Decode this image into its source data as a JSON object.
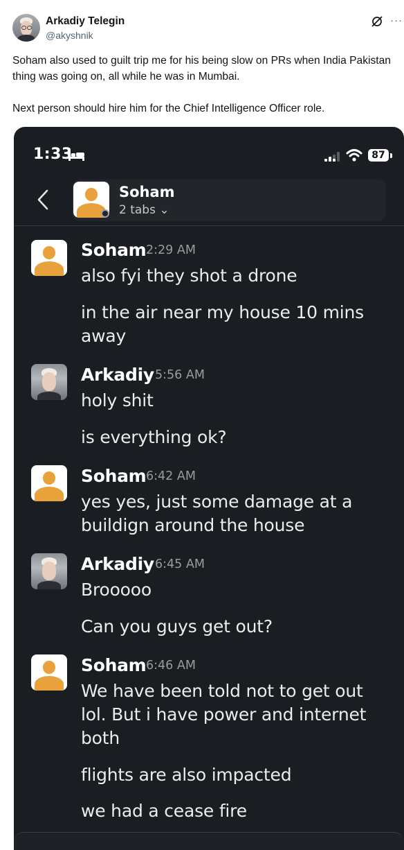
{
  "post": {
    "author_name": "Arkadiy Telegin",
    "author_handle": "@akyshnik",
    "more_label": "···",
    "text_paragraphs": [
      "Soham also used to guilt trip me for his being slow on PRs when India Pakistan thing was going on, all while he was in Mumbai.",
      "Next person should hire him for the Chief Intelligence Officer role."
    ]
  },
  "screenshot": {
    "status_bar": {
      "time": "1:33",
      "battery": "87"
    },
    "channel": {
      "name": "Soham",
      "tabs": "2 tabs ⌄"
    },
    "messages": [
      {
        "author": "Soham",
        "time": "2:29 AM",
        "lines": [
          "also fyi they shot a drone",
          "in the air near my house 10 mins away"
        ]
      },
      {
        "author": "Arkadiy",
        "time": "5:56 AM",
        "lines": [
          "holy shit",
          "is everything ok?"
        ]
      },
      {
        "author": "Soham",
        "time": "6:42 AM",
        "lines": [
          "yes yes, just some damage at a buildign around the house"
        ]
      },
      {
        "author": "Arkadiy",
        "time": "6:45 AM",
        "lines": [
          "Brooooo",
          "Can you guys get out?"
        ]
      },
      {
        "author": "Soham",
        "time": "6:46 AM",
        "lines": [
          "We have been told not to get out lol. But i have power and internet both",
          "flights are also impacted",
          "we had a cease fire"
        ]
      }
    ]
  },
  "colors": {
    "slack_bg": "#1a1d21",
    "placeholder_avatar": "#e9a23b",
    "timestamp_gray": "#9a9b9d"
  },
  "icons": [
    "grok-icon",
    "more-icon",
    "bed-icon",
    "signal-icon",
    "wifi-icon",
    "back-chevron-icon"
  ]
}
